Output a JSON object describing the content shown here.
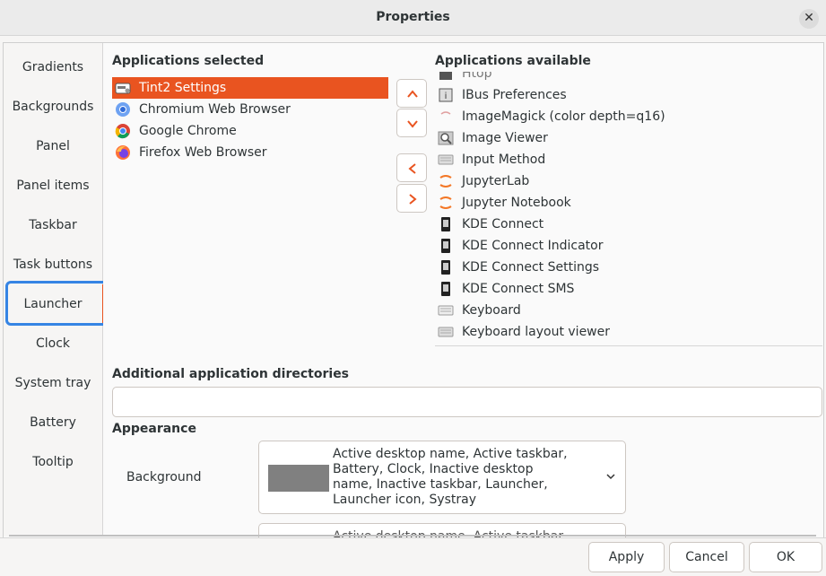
{
  "window": {
    "title": "Properties",
    "close_icon": "close-icon"
  },
  "sidebar": {
    "items": [
      {
        "label": "Gradients"
      },
      {
        "label": "Backgrounds"
      },
      {
        "label": "Panel"
      },
      {
        "label": "Panel items"
      },
      {
        "label": "Taskbar"
      },
      {
        "label": "Task buttons"
      },
      {
        "label": "Launcher"
      },
      {
        "label": "Clock"
      },
      {
        "label": "System tray"
      },
      {
        "label": "Battery"
      },
      {
        "label": "Tooltip"
      }
    ],
    "selected": "Launcher"
  },
  "selected_apps": {
    "heading": "Applications selected",
    "items": [
      {
        "label": "Tint2 Settings",
        "icon": "tint2-settings-icon"
      },
      {
        "label": "Chromium Web Browser",
        "icon": "chromium-icon"
      },
      {
        "label": "Google Chrome",
        "icon": "chrome-icon"
      },
      {
        "label": "Firefox Web Browser",
        "icon": "firefox-icon"
      }
    ]
  },
  "available_apps": {
    "heading": "Applications available",
    "partial_top": "Htop",
    "items": [
      {
        "label": "IBus Preferences",
        "icon": "ibus-icon"
      },
      {
        "label": "ImageMagick (color depth=q16)",
        "icon": "imagemagick-icon"
      },
      {
        "label": "Image Viewer",
        "icon": "image-viewer-icon"
      },
      {
        "label": "Input Method",
        "icon": "keyboard-icon"
      },
      {
        "label": "JupyterLab",
        "icon": "jupyter-icon"
      },
      {
        "label": "Jupyter Notebook",
        "icon": "jupyter-icon"
      },
      {
        "label": "KDE Connect",
        "icon": "kde-connect-icon"
      },
      {
        "label": "KDE Connect Indicator",
        "icon": "kde-connect-icon"
      },
      {
        "label": "KDE Connect Settings",
        "icon": "kde-connect-icon"
      },
      {
        "label": "KDE Connect SMS",
        "icon": "kde-connect-icon"
      },
      {
        "label": "Keyboard",
        "icon": "keyboard-icon"
      },
      {
        "label": "Keyboard layout viewer",
        "icon": "keyboard-icon"
      }
    ]
  },
  "arrows": {
    "up": "move-up-icon",
    "down": "move-down-icon",
    "left": "add-icon",
    "right": "remove-icon"
  },
  "directories": {
    "heading": "Additional application directories",
    "value": ""
  },
  "appearance": {
    "heading": "Appearance",
    "background_label": "Background",
    "background_value": "Active desktop name, Active taskbar, Battery, Clock, Inactive desktop name, Inactive taskbar, Launcher, Launcher icon, Systray",
    "second_value": "Active desktop name, Active taskbar,"
  },
  "footer": {
    "apply": "Apply",
    "cancel": "Cancel",
    "ok": "OK"
  },
  "colors": {
    "accent": "#e95420",
    "focus": "#3584e4"
  }
}
